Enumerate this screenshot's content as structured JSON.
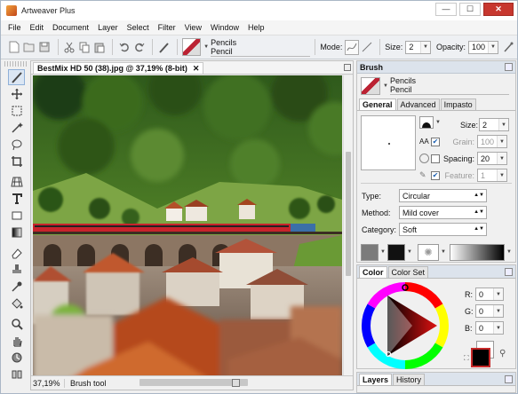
{
  "app": {
    "title": "Artweaver Plus"
  },
  "window_controls": {
    "minimize": "—",
    "maximize": "☐",
    "close": "✕"
  },
  "menu": [
    "File",
    "Edit",
    "Document",
    "Layer",
    "Select",
    "Filter",
    "View",
    "Window",
    "Help"
  ],
  "toolbar": {
    "brush_category": "Pencils",
    "brush_name": "Pencil",
    "mode_label": "Mode:",
    "size_label": "Size:",
    "size_value": "2",
    "opacity_label": "Opacity:",
    "opacity_value": "100"
  },
  "document": {
    "tab_title": "BestMix HD 50 (38).jpg @ 37,19% (8-bit)",
    "close": "✕",
    "zoom": "37,19%",
    "status_tool": "Brush tool"
  },
  "brush_panel": {
    "title": "Brush",
    "category": "Pencils",
    "name": "Pencil",
    "tabs": [
      "General",
      "Advanced",
      "Impasto"
    ],
    "size_label": "Size:",
    "size_value": "2",
    "grain_label": "Grain:",
    "grain_value": "100",
    "spacing_label": "Spacing:",
    "spacing_value": "20",
    "feature_label": "Feature:",
    "feature_value": "1",
    "type_label": "Type:",
    "type_value": "Circular",
    "method_label": "Method:",
    "method_value": "Mild cover",
    "category_label": "Category:",
    "category_value": "Soft"
  },
  "color_panel": {
    "tabs": [
      "Color",
      "Color Set"
    ],
    "r_label": "R:",
    "r_value": "0",
    "g_label": "G:",
    "g_value": "0",
    "b_label": "B:",
    "b_value": "0",
    "foreground": "#000000",
    "background": "#ffffff"
  },
  "layers_panel": {
    "tabs": [
      "Layers",
      "History"
    ]
  },
  "colors": {
    "accent": "#c62828",
    "titlebar_close": "#c7372f",
    "panel_header": "#dce3ec"
  }
}
